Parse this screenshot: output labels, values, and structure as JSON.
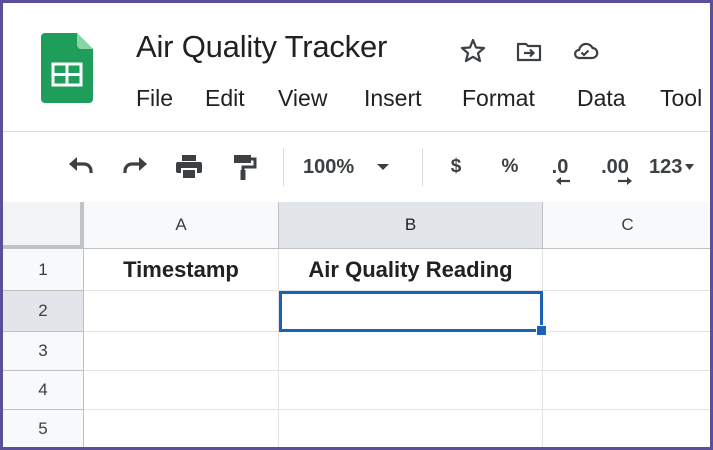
{
  "header": {
    "title": "Air Quality Tracker",
    "icons": [
      "sheets-logo-icon",
      "star-icon",
      "move-to-folder-icon",
      "cloud-status-icon"
    ]
  },
  "menu": {
    "items": [
      "File",
      "Edit",
      "View",
      "Insert",
      "Format",
      "Data",
      "Tool"
    ]
  },
  "toolbar": {
    "icons": [
      "undo-icon",
      "redo-icon",
      "print-icon",
      "paint-format-icon"
    ],
    "zoom": "100%",
    "currency": "$",
    "percent": "%",
    "decrease_decimal": ".0",
    "increase_decimal": ".00",
    "more_formats": "123"
  },
  "sheet": {
    "columns": [
      "A",
      "B",
      "C"
    ],
    "rows": [
      "1",
      "2",
      "3",
      "4",
      "5"
    ],
    "cells": {
      "A1": "Timestamp",
      "B1": "Air Quality Reading"
    },
    "selected_cell": "B2"
  },
  "colors": {
    "accent": "#1a62b7",
    "sheets_green": "#1e9e5a",
    "frame": "#5b4f9a"
  }
}
